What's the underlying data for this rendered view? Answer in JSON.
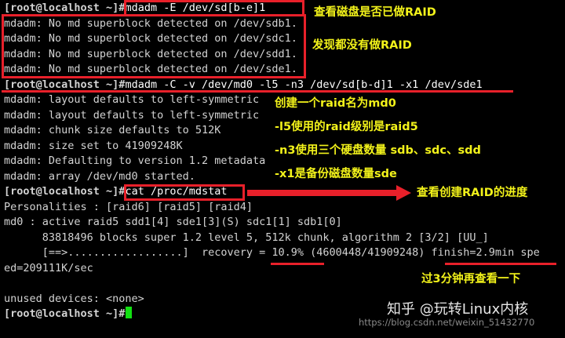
{
  "terminal": {
    "prompt": "[root@localhost ~]#",
    "lines": [
      {
        "type": "cmd",
        "text": "mdadm -E /dev/sd[b-e]1"
      },
      {
        "type": "out",
        "text": "mdadm: No md superblock detected on /dev/sdb1."
      },
      {
        "type": "out",
        "text": "mdadm: No md superblock detected on /dev/sdc1."
      },
      {
        "type": "out",
        "text": "mdadm: No md superblock detected on /dev/sdd1."
      },
      {
        "type": "out",
        "text": "mdadm: No md superblock detected on /dev/sde1."
      },
      {
        "type": "cmd",
        "text": "mdadm -C -v /dev/md0 -l5 -n3 /dev/sd[b-d]1 -x1 /dev/sde1"
      },
      {
        "type": "out",
        "text": "mdadm: layout defaults to left-symmetric"
      },
      {
        "type": "out",
        "text": "mdadm: layout defaults to left-symmetric"
      },
      {
        "type": "out",
        "text": "mdadm: chunk size defaults to 512K"
      },
      {
        "type": "out",
        "text": "mdadm: size set to 41909248K"
      },
      {
        "type": "out",
        "text": "mdadm: Defaulting to version 1.2 metadata"
      },
      {
        "type": "out",
        "text": "mdadm: array /dev/md0 started."
      },
      {
        "type": "cmd",
        "text": "cat /proc/mdstat"
      },
      {
        "type": "out",
        "text": "Personalities : [raid6] [raid5] [raid4]"
      },
      {
        "type": "out",
        "text": "md0 : active raid5 sdd1[4] sde1[3](S) sdc1[1] sdb1[0]"
      },
      {
        "type": "out",
        "text": "      83818496 blocks super 1.2 level 5, 512k chunk, algorithm 2 [3/2] [UU_]"
      },
      {
        "type": "out",
        "text": "      [==>..................]  recovery = 10.9% (4600448/41909248) finish=2.9min spe"
      },
      {
        "type": "out",
        "text": "ed=209111K/sec"
      },
      {
        "type": "out",
        "text": ""
      },
      {
        "type": "out",
        "text": "unused devices: <none>"
      },
      {
        "type": "cmd",
        "text": ""
      }
    ]
  },
  "annotations": {
    "check_raid": "查看磁盘是否已做RAID",
    "no_raid": "发现都没有做RAID",
    "create_raid": "创建一个raid名为md0",
    "level": "-l5使用的raid级别是raid5",
    "disks": "-n3使用三个硬盘数量 sdb、sdc、sdd",
    "spare": "-x1是备份磁盘数量sde",
    "progress": "查看创建RAID的进度",
    "recheck": "过3分钟再查看一下"
  },
  "watermark": {
    "brand": "知乎 @玩转Linux内核",
    "url": "https://blog.csdn.net/weixin_51432770"
  },
  "colors": {
    "annotation": "#f2f21a",
    "highlight": "#e8202a",
    "cursor": "#12e012"
  }
}
